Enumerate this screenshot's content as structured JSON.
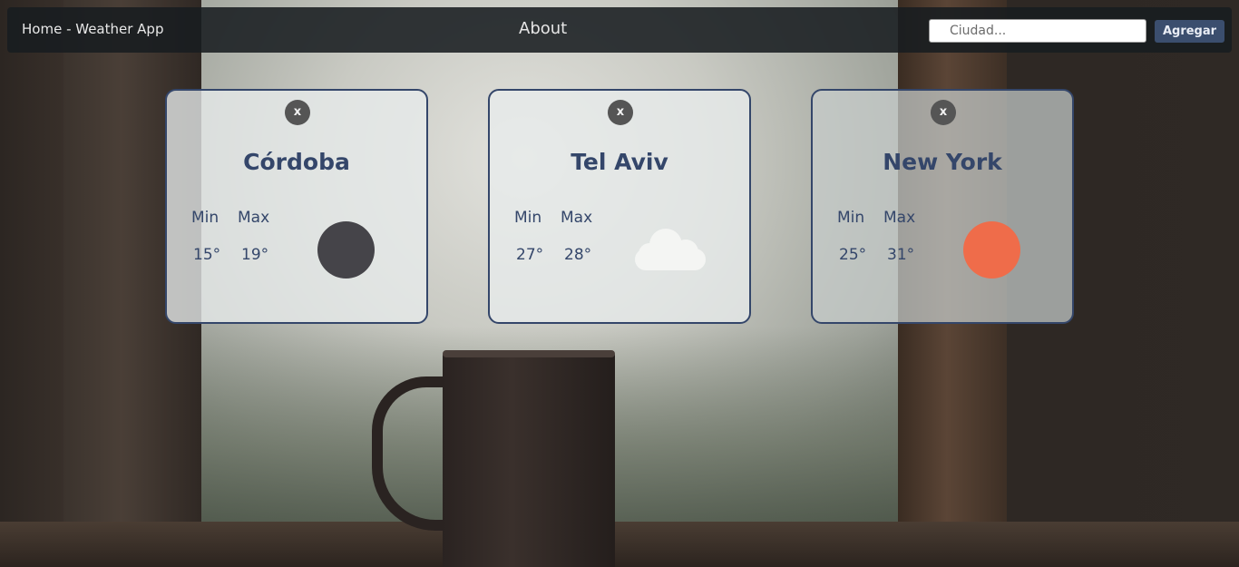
{
  "navbar": {
    "home_label": "Home - Weather App",
    "about_label": "About",
    "search_placeholder": "Ciudad...",
    "search_value": "",
    "add_label": "Agregar",
    "accent_color": "#3b4e6e"
  },
  "cards": [
    {
      "close_label": "x",
      "city": "Córdoba",
      "min_label": "Min",
      "max_label": "Max",
      "min": "15°",
      "max": "19°",
      "icon": "moon-circle-icon",
      "icon_color": "#454449"
    },
    {
      "close_label": "x",
      "city": "Tel Aviv",
      "min_label": "Min",
      "max_label": "Max",
      "min": "27°",
      "max": "28°",
      "icon": "cloud-icon",
      "icon_color": "#f4f5f3"
    },
    {
      "close_label": "x",
      "city": "New York",
      "min_label": "Min",
      "max_label": "Max",
      "min": "25°",
      "max": "31°",
      "icon": "sun-circle-icon",
      "icon_color": "#ef6c4a"
    }
  ],
  "theme": {
    "card_border": "#34466a",
    "text_color": "#34466a"
  }
}
